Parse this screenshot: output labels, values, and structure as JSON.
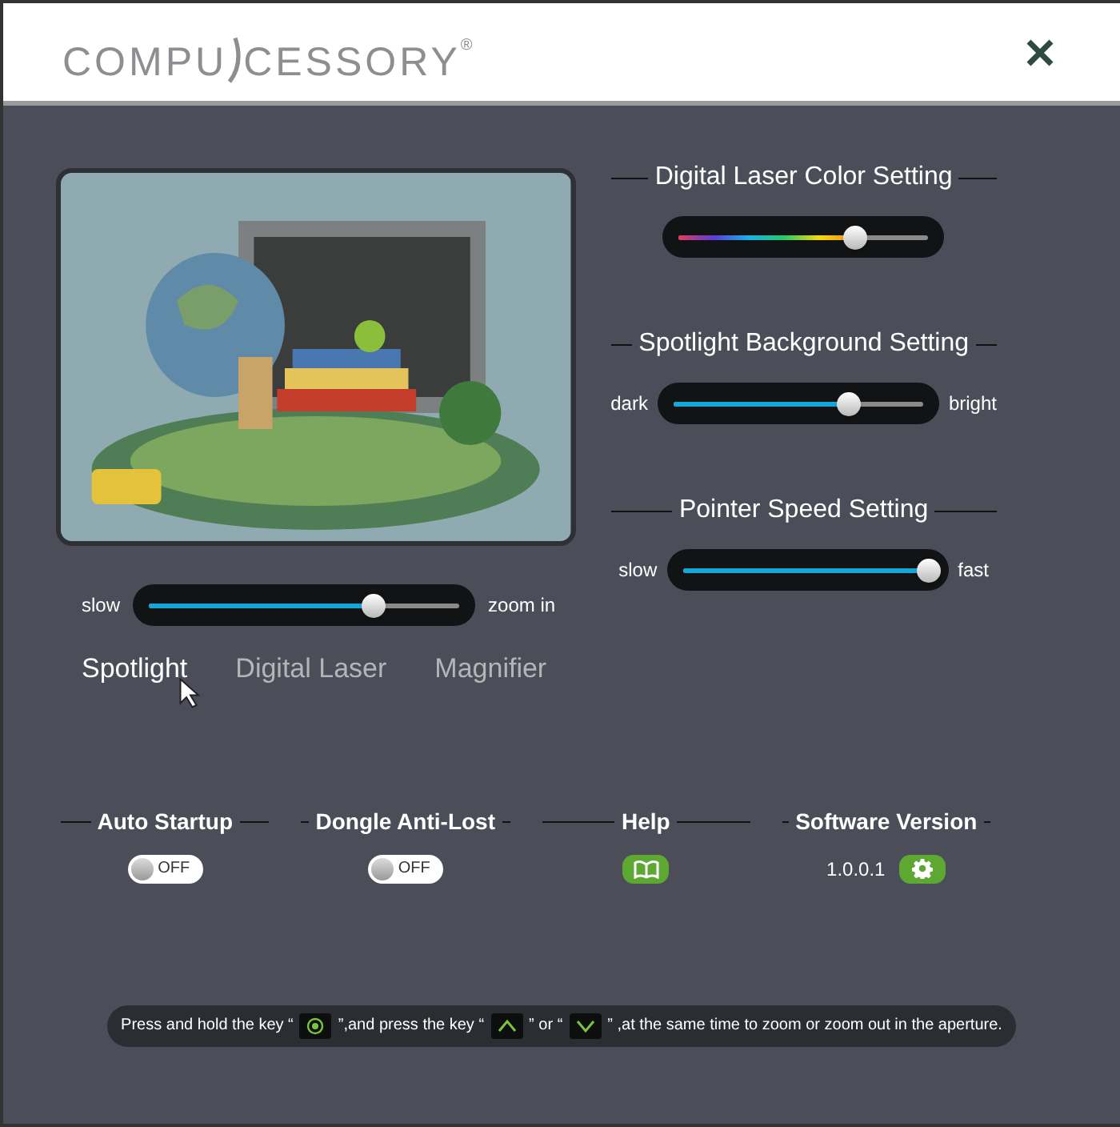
{
  "header": {
    "logo": {
      "left": "COMPU",
      "right": "CESSORY",
      "mark": "®"
    }
  },
  "zoom_slider": {
    "min_label": "slow",
    "max_label": "zoom in",
    "level": 0.72
  },
  "modes": [
    {
      "label": "Spotlight",
      "selected": true
    },
    {
      "label": "Digital Laser",
      "selected": false
    },
    {
      "label": "Magnifier",
      "selected": false
    }
  ],
  "settings": [
    {
      "title": "Digital Laser Color Setting",
      "kind": "color",
      "level": 0.7
    },
    {
      "title": "Spotlight Background Setting",
      "kind": "range",
      "min_label": "dark",
      "max_label": "bright",
      "level": 0.7
    },
    {
      "title": "Pointer Speed Setting",
      "kind": "range",
      "min_label": "slow",
      "max_label": "fast",
      "level": 0.98
    }
  ],
  "options": [
    {
      "title": "Auto Startup",
      "kind": "toggle",
      "on": false,
      "state_label": "OFF"
    },
    {
      "title": "Dongle Anti-Lost",
      "kind": "toggle",
      "on": false,
      "state_label": "OFF"
    },
    {
      "title": "Help",
      "kind": "help"
    },
    {
      "title": "Software Version",
      "kind": "version",
      "version": "1.0.0.1"
    }
  ],
  "instruction": [
    "Press and hold the key “",
    "”,and press the key “",
    "” or “",
    "” ,at the same time to zoom or zoom out in the aperture."
  ]
}
